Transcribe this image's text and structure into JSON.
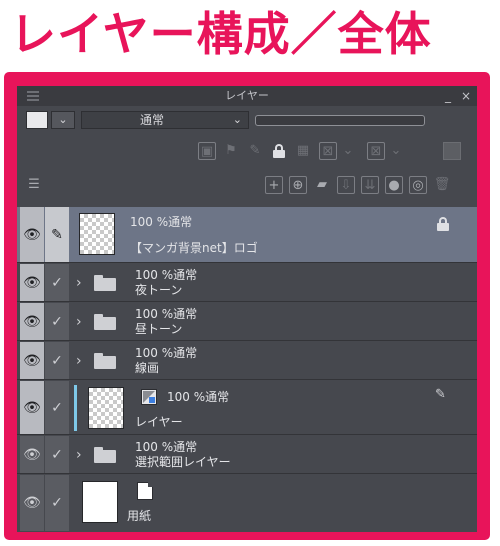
{
  "heading": "レイヤー構成／全体",
  "panel": {
    "title": "レイヤー",
    "minimize_label": "_",
    "close_label": "×",
    "blend_mode": "通常",
    "blend_chevron": "⌄",
    "color_drop_label": "⌄"
  },
  "toolbar1_icons": [
    "clip-to-below-icon",
    "reference-layer-icon",
    "draft-layer-icon",
    "lock-icon",
    "lock-transparent-icon",
    "mask-enable-icon",
    "chevron-down-icon",
    "ruler-display-icon",
    "chevron-down-icon",
    "color-chip-icon"
  ],
  "toolbar2_icons": [
    "layer-property-icon",
    "new-raster-layer-icon",
    "new-vector-layer-icon",
    "new-folder-icon",
    "transfer-down-icon",
    "combine-down-icon",
    "mask-icon",
    "apply-mask-icon",
    "delete-layer-icon"
  ],
  "layers": [
    {
      "opacity_mode": "100 %通常",
      "name": "【マンガ背景net】ロゴ",
      "type": "raster",
      "selected": true,
      "locked": true
    },
    {
      "opacity_mode": "100 %通常",
      "name": "夜トーン",
      "type": "folder"
    },
    {
      "opacity_mode": "100 %通常",
      "name": "昼トーン",
      "type": "folder"
    },
    {
      "opacity_mode": "100 %通常",
      "name": "線画",
      "type": "folder"
    },
    {
      "opacity_mode": "100 %通常",
      "name": "レイヤー",
      "type": "raster"
    },
    {
      "opacity_mode": "100 %通常",
      "name": "選択範囲レイヤー",
      "type": "folder"
    },
    {
      "opacity_mode": "",
      "name": "用紙",
      "type": "paper"
    }
  ],
  "symbols": {
    "eye": "👁",
    "check": "✓",
    "pen": "✎",
    "chevron_right": "›"
  },
  "colors": {
    "accent": "#e8145a",
    "panel_bg": "#46484e",
    "selected_row": "#6d7587"
  }
}
